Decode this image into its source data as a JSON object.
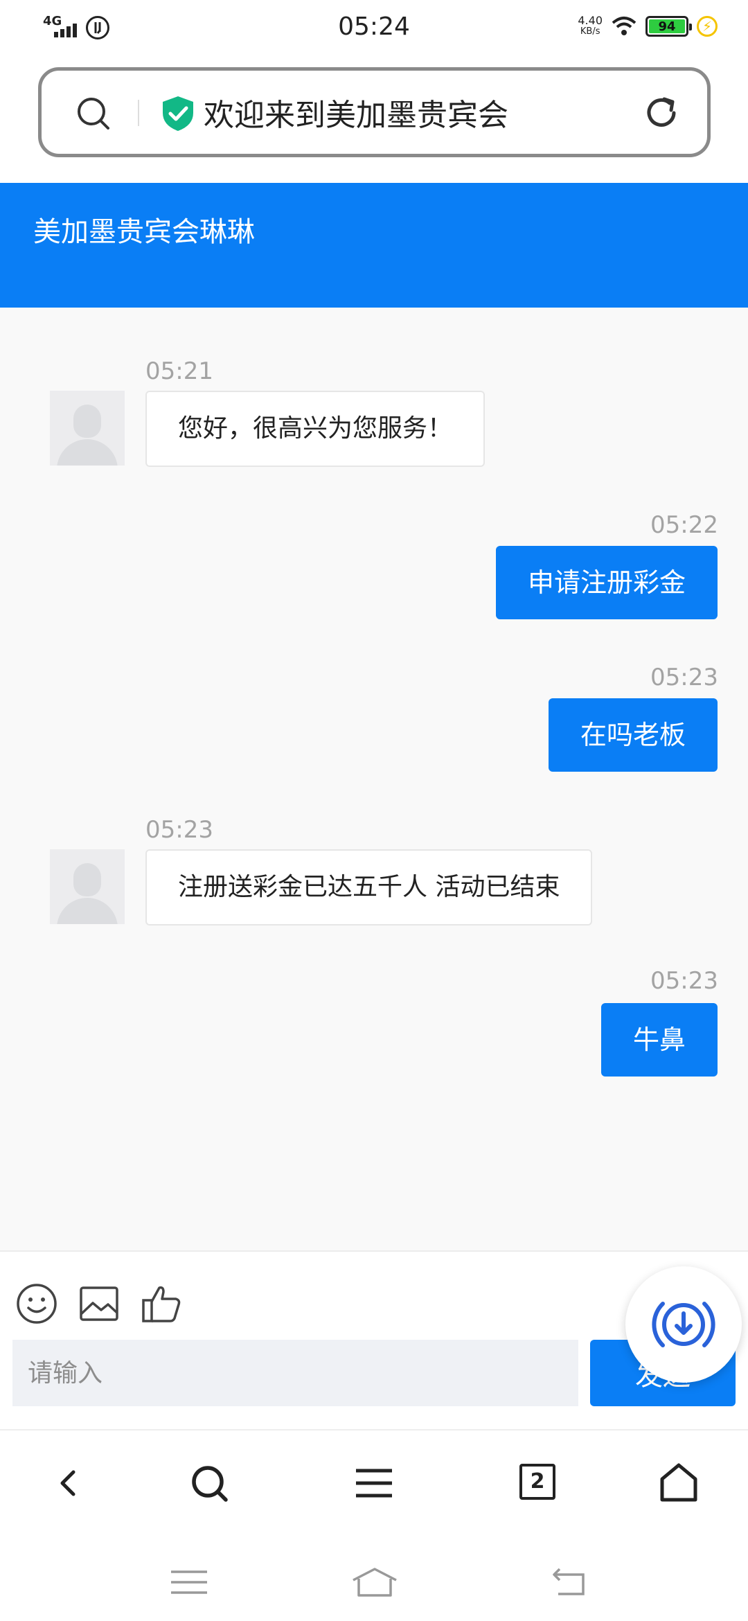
{
  "status_bar": {
    "network": "4G",
    "time": "05:24",
    "speed_value": "4.40",
    "speed_unit": "KB/s",
    "battery": "94"
  },
  "url_bar": {
    "title": "欢迎来到美加墨贵宾会"
  },
  "chat": {
    "header_title": "美加墨贵宾会琳琳",
    "messages": [
      {
        "side": "in",
        "time": "05:21",
        "text": "您好，很高兴为您服务！"
      },
      {
        "side": "out",
        "time": "05:22",
        "text": "申请注册彩金"
      },
      {
        "side": "out",
        "time": "05:23",
        "text": "在吗老板"
      },
      {
        "side": "in",
        "time": "05:23",
        "text": "注册送彩金已达五千人 活动已结束"
      },
      {
        "side": "out",
        "time": "05:23",
        "text": "牛鼻"
      }
    ]
  },
  "input": {
    "placeholder": "请输入",
    "send_label": "发送"
  },
  "browser_nav": {
    "tab_count": "2"
  },
  "colors": {
    "accent": "#0a7ef5",
    "shield": "#12b886"
  },
  "icons": {
    "tools": [
      "emoji-icon",
      "image-icon",
      "thumbs-up-icon"
    ],
    "nav": [
      "back-icon",
      "search-icon",
      "menu-icon",
      "tabs-icon",
      "home-icon"
    ],
    "system": [
      "recent-apps-icon",
      "home-icon",
      "back-icon"
    ]
  }
}
